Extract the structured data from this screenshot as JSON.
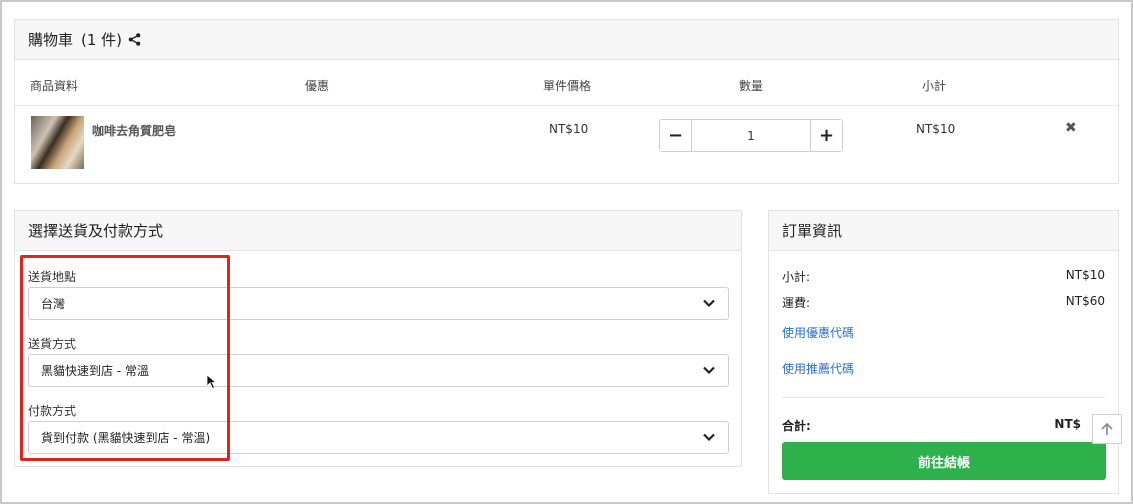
{
  "cart": {
    "title": "購物車",
    "count": "(1 件)",
    "columns": {
      "product": "商品資料",
      "discount": "優惠",
      "unit_price": "單件價格",
      "quantity": "數量",
      "subtotal": "小計"
    },
    "items": [
      {
        "name": "咖啡去角質肥皂",
        "unit_price": "NT$10",
        "quantity": "1",
        "subtotal": "NT$10",
        "remove_icon": "close-icon"
      }
    ]
  },
  "shipping": {
    "title": "選擇送貨及付款方式",
    "fields": [
      {
        "label": "送貨地點",
        "value": "台灣"
      },
      {
        "label": "送貨方式",
        "value": "黑貓快速到店 - 常溫"
      },
      {
        "label": "付款方式",
        "value": "貨到付款 (黑貓快速到店 - 常溫)"
      }
    ],
    "highlight_color": "#e0231c"
  },
  "order": {
    "title": "訂單資訊",
    "subtotal_label": "小計:",
    "subtotal_value": "NT$10",
    "shipping_label": "運費:",
    "shipping_value": "NT$60",
    "coupon_link": "使用優惠代碼",
    "referral_link": "使用推薦代碼",
    "total_label": "合計:",
    "total_value": "NT$",
    "checkout_label": "前往結帳",
    "checkout_color": "#2eb14a"
  },
  "icons": {
    "share": "share-icon",
    "chevron": "chevron-down-icon",
    "to_top": "arrow-up-icon",
    "cursor": "mouse-cursor-icon"
  }
}
